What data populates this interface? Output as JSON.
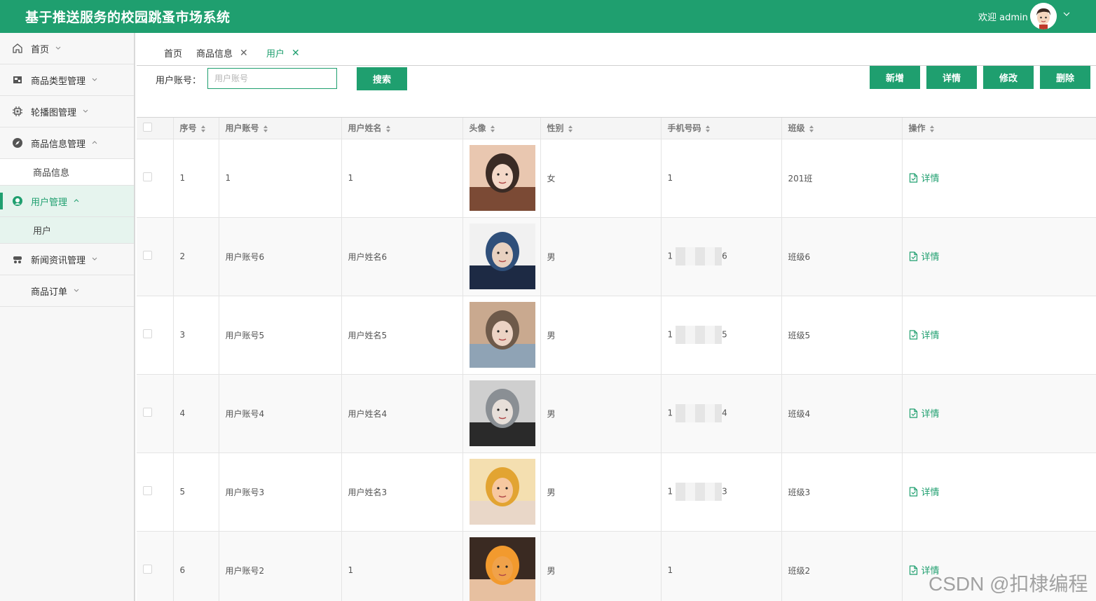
{
  "header": {
    "title": "基于推送服务的校园跳蚤市场系统",
    "welcome": "欢迎 admin"
  },
  "sidebar": {
    "items": [
      {
        "label": "首页",
        "icon": "home-icon"
      },
      {
        "label": "商品类型管理",
        "icon": "category-icon"
      },
      {
        "label": "轮播图管理",
        "icon": "chip-icon"
      },
      {
        "label": "商品信息管理",
        "icon": "compass-icon",
        "sub": "商品信息"
      },
      {
        "label": "用户管理",
        "icon": "user-icon",
        "sub": "用户"
      },
      {
        "label": "新闻资讯管理",
        "icon": "news-icon"
      },
      {
        "label": "商品订单",
        "icon": ""
      }
    ]
  },
  "tabs": [
    {
      "label": "首页"
    },
    {
      "label": "商品信息"
    },
    {
      "label": "用户"
    }
  ],
  "search": {
    "label": "用户账号：",
    "placeholder": "用户账号",
    "button": "搜索"
  },
  "actions": {
    "add": "新增",
    "detail": "详情",
    "edit": "修改",
    "delete": "删除"
  },
  "table": {
    "headers": [
      "序号",
      "用户账号",
      "用户姓名",
      "头像",
      "性别",
      "手机号码",
      "班级",
      "操作"
    ],
    "detail_label": "详情",
    "rows": [
      {
        "no": "1",
        "account": "1",
        "name": "1",
        "gender": "女",
        "phone_start": "1",
        "phone_end": "",
        "class": "201班"
      },
      {
        "no": "2",
        "account": "用户账号6",
        "name": "用户姓名6",
        "gender": "男",
        "phone_start": "1",
        "phone_end": "6",
        "class": "班级6"
      },
      {
        "no": "3",
        "account": "用户账号5",
        "name": "用户姓名5",
        "gender": "男",
        "phone_start": "1",
        "phone_end": "5",
        "class": "班级5"
      },
      {
        "no": "4",
        "account": "用户账号4",
        "name": "用户姓名4",
        "gender": "男",
        "phone_start": "1",
        "phone_end": "4",
        "class": "班级4"
      },
      {
        "no": "5",
        "account": "用户账号3",
        "name": "用户姓名3",
        "gender": "男",
        "phone_start": "1",
        "phone_end": "3",
        "class": "班级3"
      },
      {
        "no": "6",
        "account": "用户账号2",
        "name": "1",
        "gender": "男",
        "phone_start": "1",
        "phone_end": "",
        "class": "班级2"
      }
    ]
  },
  "watermark": "CSDN @扣棣编程",
  "colors": {
    "primary": "#1f9f6f"
  }
}
